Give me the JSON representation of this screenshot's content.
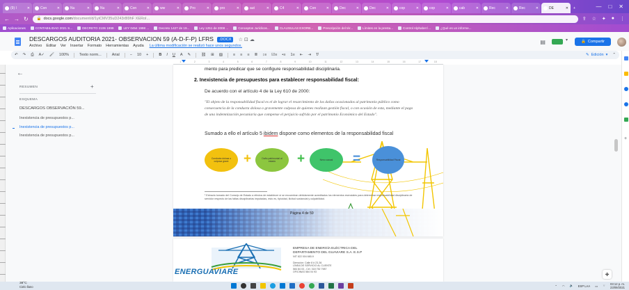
{
  "browser": {
    "tabs": [
      {
        "label": "(9) I"
      },
      {
        "label": "Con"
      },
      {
        "label": "Nu"
      },
      {
        "label": "Nu"
      },
      {
        "label": "Con"
      },
      {
        "label": "ww"
      },
      {
        "label": "Pro"
      },
      {
        "label": "pro"
      },
      {
        "label": "aut"
      },
      {
        "label": "C4"
      },
      {
        "label": "Con"
      },
      {
        "label": "Dec"
      },
      {
        "label": "Dec"
      },
      {
        "label": "cop"
      },
      {
        "label": "cop"
      },
      {
        "label": "cab"
      },
      {
        "label": "Rec"
      },
      {
        "label": "Rec"
      },
      {
        "label": "DE"
      }
    ],
    "address": {
      "host": "docs.google.com",
      "path": "/document/d/1yiCMV35uD243r8l9hF XERoI..."
    },
    "bookmarks": [
      "Aplicaciones",
      "CONTABILIDAD 2021 S...",
      "DECRETO 2106 1999",
      "LEY 0454 1998 ...",
      "Decreto 1427 de 19...",
      "Ley 1251 de 2008 ...",
      "Conceptos Jurídicos...",
      "CLAUSULAS EXORB...",
      "Prescripción del tér...",
      "Límites en la presta...",
      "Control Alphabet l...",
      "¿Qué es un informe..."
    ]
  },
  "doc": {
    "title": "DESCARGOS AUDITORIA 2021- OBSERVACION 59 (A-D-F-P) LFRS",
    "badge": ".DOCX",
    "menu": [
      "Archivo",
      "Editar",
      "Ver",
      "Insertar",
      "Formato",
      "Herramientas",
      "Ayuda"
    ],
    "last_edit": "La última modificación se realizó hace unos segundos.",
    "share_label": "Compartir",
    "toolbar": {
      "zoom": "100%",
      "style": "Texto norm...",
      "font": "Arial",
      "font_size": "10",
      "mode": "Edición"
    },
    "ruler_ticks": [
      "1",
      "2",
      "3",
      "4",
      "5",
      "6",
      "7",
      "8",
      "9",
      "10",
      "11",
      "12",
      "13",
      "14",
      "15",
      "16",
      "17",
      "18"
    ]
  },
  "outline": {
    "summary_header": "RESUMEN",
    "outline_header": "ESQUEMA",
    "items": [
      {
        "label": "DESCARGOS OBSERVACIÓN 59...",
        "level": "top"
      },
      {
        "label": "Inexistencia de presupuestos p...",
        "level": "sub"
      },
      {
        "label": "Inexistencia de presupuestos p...",
        "level": "sub",
        "active": true
      },
      {
        "label": "Inexistencia de presupuestos p...",
        "level": "sub"
      }
    ]
  },
  "page": {
    "line1": "mento para predicar que se configure responsabilidad disciplinaria.",
    "heading": "2.  Inexistencia de presupuestos para establecer responsabilidad fiscal:",
    "para2": "De acuerdo con el artículo 4 de la Ley 610 de 2000:",
    "quote": "\"El objeto de la responsabilidad fiscal es el de lograr el resarcimiento de los daños ocasionados al patrimonio público como consecuencia de la conducta dolosa o gravemente culposa de quienes realizan gestión fiscal, o con ocasión de esta, mediante el pago de una indemnización pecuniaria que compense el perjuicio sufrido por el patrimonio Económico del Estado\".",
    "para3_a": "Sumado a ello el artículo 5 ",
    "para3_u": "ibidem",
    "para3_b": " dispone como elementos de la responsabilidad fiscal",
    "diagram": {
      "items": [
        "Conducta dolosa o culposa grave",
        "Daño patrimonial al estado",
        "Nexo causal",
        "Responsabilidad Fiscal"
      ],
      "operators": [
        "+",
        "+",
        "="
      ],
      "colors": [
        "#f2c10f",
        "#8cc63f",
        "#3fc46a",
        "#4a90d9"
      ],
      "operator_colors": [
        "#f2c10f",
        "#3fbe4a",
        "#4a90d9"
      ]
    },
    "footnote": "¹ Extracto tomado del Consejo de Estado a efectos de establecer  si se encuentran debidamente acreditados los elementos esenciales para determinar responsabilidad disciplinaria de servidor respecto de las faltas disciplinarias imputadas, esto es, tipicidad, ilicitud sustancial y culpabilidad.",
    "page_number": "Página 4 de 59"
  },
  "page2": {
    "logo_text": "ENERGUAVIARE",
    "company_line1": "EMPRESA DE ENERGÍA ELÉCTRICA DEL",
    "company_line2": "DEPARTAMENTO DEL GUAVIARE S.A. E.S.P",
    "nit": "NIT 822 004 680-9",
    "address_lines": [
      "Dirección: Calle 8 # 23-36",
      "LÍNEA DE SERVICIO AL CLIENTE",
      "584 84 03 - Cel. 318 752 7987",
      "OFICINAS 584 04 93"
    ]
  },
  "taskbar": {
    "weather_temp": "38°C",
    "weather_desc": "Cielo llano",
    "lang": "ESP LAA",
    "time": "03:12 p. m.",
    "date": "23/09/2021"
  }
}
